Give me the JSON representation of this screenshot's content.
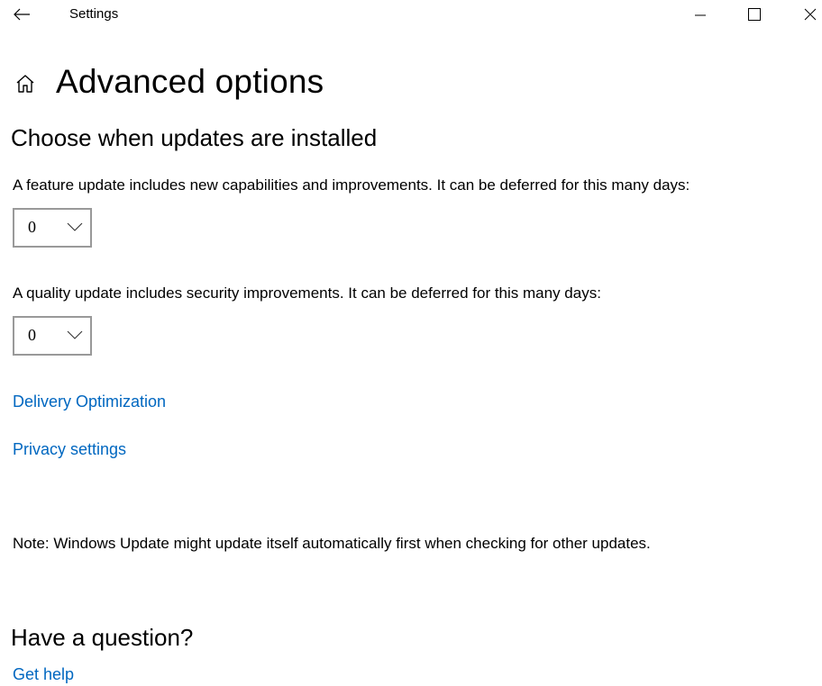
{
  "window": {
    "title": "Settings",
    "controls": {
      "minimize": "minimize-icon",
      "maximize": "maximize-icon",
      "close": "close-icon"
    }
  },
  "page": {
    "title": "Advanced options",
    "home_icon": "home-icon"
  },
  "updates": {
    "heading": "Choose when updates are installed",
    "feature": {
      "description": "A feature update includes new capabilities and improvements. It can be deferred for this many days:",
      "selected_value": "0"
    },
    "quality": {
      "description": "A quality update includes security improvements. It can be deferred for this many days:",
      "selected_value": "0"
    }
  },
  "links": {
    "delivery_optimization": "Delivery Optimization",
    "privacy_settings": "Privacy settings"
  },
  "note": "Note: Windows Update might update itself automatically first when checking for other updates.",
  "help": {
    "heading": "Have a question?",
    "link": "Get help"
  },
  "colors": {
    "link": "#0067c0",
    "select_border": "#999999",
    "background": "#ffffff"
  }
}
